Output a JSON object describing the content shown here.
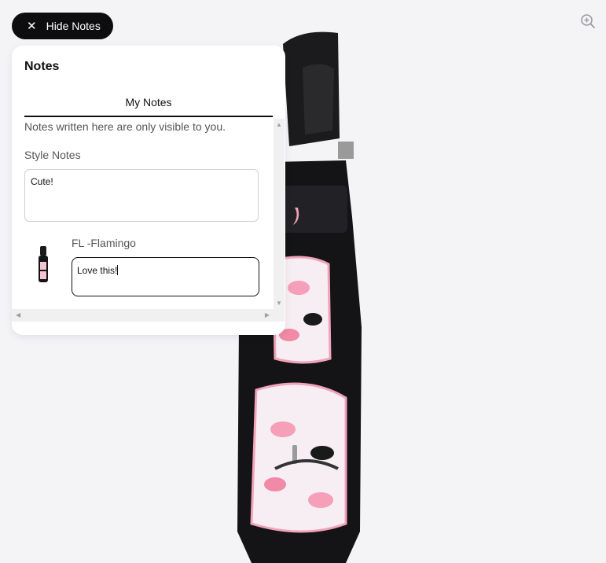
{
  "toolbar": {
    "hide_notes_label": "Hide Notes"
  },
  "notes": {
    "title": "Notes",
    "tab_label": "My Notes",
    "hint": "Notes written here are only visible to you.",
    "style_notes_label": "Style Notes",
    "style_notes_value": "Cute!",
    "items": [
      {
        "name": "FL -Flamingo",
        "note": "Love this!"
      }
    ]
  },
  "icons": {
    "close": "close-icon",
    "zoom": "zoom-in-icon"
  },
  "colors": {
    "button_bg": "#0d0d10",
    "page_bg": "#f4f4f7",
    "bag_pink": "#f2a3b8"
  }
}
